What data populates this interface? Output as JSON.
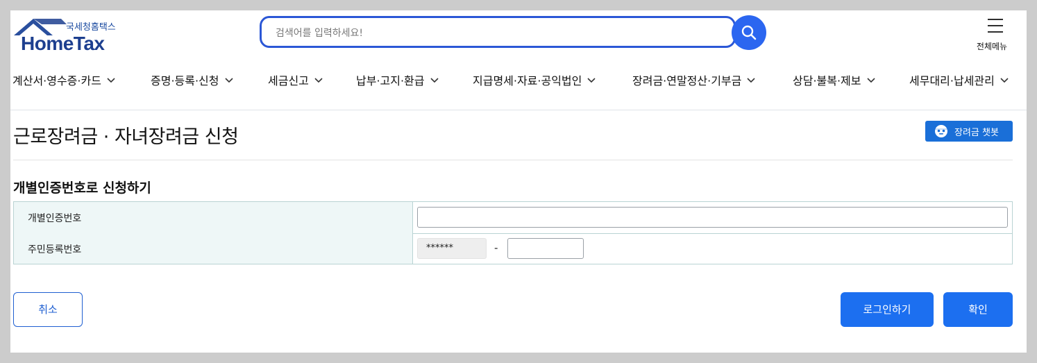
{
  "header": {
    "logo_kr": "국세청홈택스",
    "logo_en": "HomeTax",
    "search_placeholder": "검색어를 입력하세요!",
    "menu_label": "전체메뉴"
  },
  "nav": {
    "items": [
      {
        "label": "계산서·영수증·카드"
      },
      {
        "label": "증명·등록·신청"
      },
      {
        "label": "세금신고"
      },
      {
        "label": "납부·고지·환급"
      },
      {
        "label": "지급명세·자료·공익법인"
      },
      {
        "label": "장려금·연말정산·기부금"
      },
      {
        "label": "상담·불복·제보"
      },
      {
        "label": "세무대리·납세관리"
      }
    ]
  },
  "page": {
    "title": "근로장려금 · 자녀장려금 신청",
    "chatbot_label": "장려금 챗봇",
    "section_title": "개별인증번호로 신청하기"
  },
  "form": {
    "cert_label": "개별인증번호",
    "cert_value": "",
    "rrn_label": "주민등록번호",
    "rrn_front": "******",
    "rrn_separator": "-",
    "rrn_back": ""
  },
  "buttons": {
    "cancel": "취소",
    "login": "로그인하기",
    "confirm": "확인"
  },
  "colors": {
    "primary": "#1c6ff0",
    "logo_navy": "#1d3f8f",
    "table_header_bg": "#eef7f7"
  }
}
